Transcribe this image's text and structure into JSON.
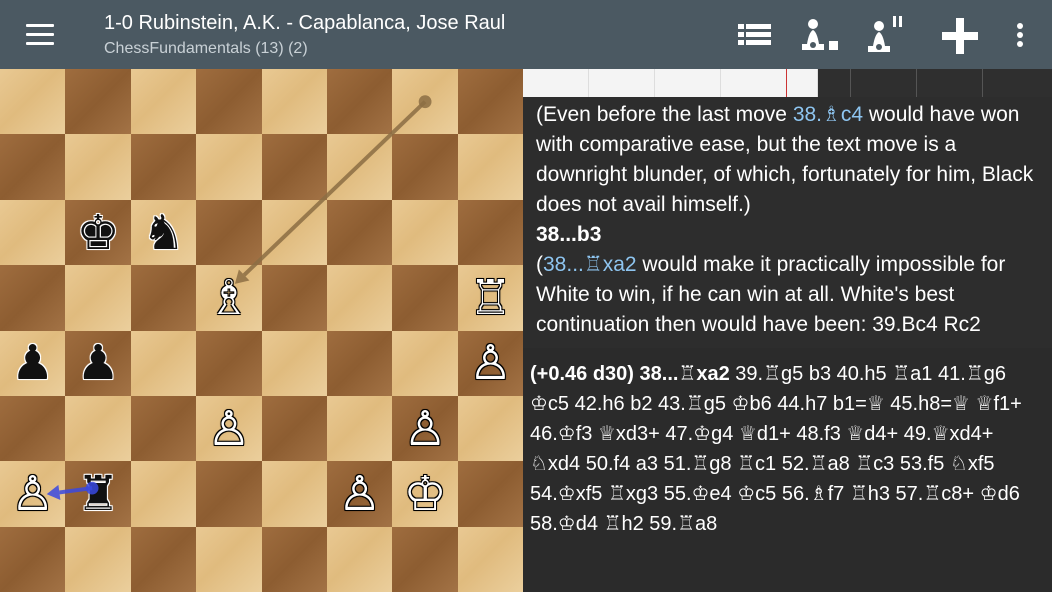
{
  "header": {
    "title": "1-0 Rubinstein, A.K. - Capablanca, Jose Raul",
    "subtitle": "ChessFundamentals (13) (2)",
    "actions": [
      {
        "name": "list-icon"
      },
      {
        "name": "engine-settings-icon"
      },
      {
        "name": "engine-pause-icon"
      },
      {
        "name": "plus-icon"
      },
      {
        "name": "more-vert-icon"
      }
    ]
  },
  "board": {
    "light_color": "#e3c087",
    "dark_color": "#985f33",
    "arrow_color": "#8c6e44",
    "last_move_arrow_color": "#3a49e0",
    "pieces": [
      {
        "square": "b6",
        "glyph": "♚",
        "side": "black",
        "name": "black-king"
      },
      {
        "square": "c6",
        "glyph": "♞",
        "side": "black",
        "name": "black-knight"
      },
      {
        "square": "d5",
        "glyph": "♗",
        "side": "white",
        "name": "white-bishop"
      },
      {
        "square": "h5",
        "glyph": "♖",
        "side": "white",
        "name": "white-rook"
      },
      {
        "square": "a4",
        "glyph": "♟",
        "side": "black",
        "name": "black-pawn"
      },
      {
        "square": "b4",
        "glyph": "♟",
        "side": "black",
        "name": "black-pawn"
      },
      {
        "square": "h4",
        "glyph": "♙",
        "side": "white",
        "name": "white-pawn"
      },
      {
        "square": "d3",
        "glyph": "♙",
        "side": "white",
        "name": "white-pawn"
      },
      {
        "square": "g3",
        "glyph": "♙",
        "side": "white",
        "name": "white-pawn"
      },
      {
        "square": "a2",
        "glyph": "♙",
        "side": "white",
        "name": "white-pawn"
      },
      {
        "square": "b2",
        "glyph": "♜",
        "side": "black",
        "name": "black-rook"
      },
      {
        "square": "f2",
        "glyph": "♙",
        "side": "white",
        "name": "white-pawn"
      },
      {
        "square": "g2",
        "glyph": "♔",
        "side": "white",
        "name": "white-king"
      }
    ]
  },
  "comment": {
    "p1_a": "(Even before the last move ",
    "p1_link": "38.♗c4",
    "p1_b": " would have won with comparative ease, but the text move is a downright blunder, of which, fortunately for him, Black does not avail himself.)",
    "move": "38...b3",
    "p2_a": "(",
    "p2_link": "38...♖xa2",
    "p2_b": " would make it practically impossible for White to win, if he can win at all. White's best continuation then would have been: 39.Bc4 Rc2"
  },
  "engine": {
    "eval": "(+0.46 d30)",
    "move": "38...♖xa2",
    "line": " 39.♖g5 b3 40.h5 ♖a1 41.♖g6 ♔c5 42.h6 b2 43.♖g5 ♔b6 44.h7 b1=♕ 45.h8=♕ ♕f1+ 46.♔f3 ♕xd3+ 47.♔g4 ♕d1+ 48.f3 ♕d4+ 49.♕xd4+ ♘xd4 50.f4 a3 51.♖g8 ♖c1 52.♖a8 ♖c3 53.f5 ♘xf5 54.♔xf5 ♖xg3 55.♔e4 ♔c5 56.♗f7 ♖h3 57.♖c8+ ♔d6 58.♔d4 ♖h2 59.♖a8"
  }
}
